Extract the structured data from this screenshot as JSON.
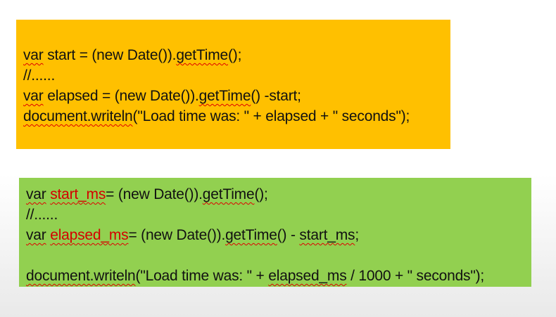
{
  "colors": {
    "orange_panel": "#ffc000",
    "green_panel": "#92d050",
    "highlight_text": "#d40000",
    "spellcheck_underline": "#e00000"
  },
  "orange_block": {
    "line1": {
      "kw": "var",
      "a": " start = (new Date()).",
      "getTime": "getTime",
      "b": "();"
    },
    "line2": {
      "text": "//......"
    },
    "line3": {
      "kw": "var",
      "a": " elapsed = (new Date()).",
      "getTime": "getTime",
      "b": "() -start;"
    },
    "line4": {
      "doc": "document.writeln",
      "rest": "(\"Load time was: \" + elapsed + \" seconds\");"
    }
  },
  "green_block": {
    "line1": {
      "kw": "var",
      "sp": " ",
      "ident": "start_ms",
      "a": "= (new Date()).",
      "getTime": "getTime",
      "b": "();"
    },
    "line2": {
      "text": "//......"
    },
    "line3": {
      "kw": "var",
      "sp": " ",
      "ident": "elapsed_ms",
      "a": "= (new Date()).",
      "getTime": "getTime",
      "b": "() - ",
      "ident2": "start_ms",
      "c": ";"
    },
    "line4": {
      "doc": "document.writeln",
      "a": "(\"Load time was: \" + ",
      "ident": "elapsed_ms",
      "b": " / 1000 + \" seconds\");"
    }
  }
}
